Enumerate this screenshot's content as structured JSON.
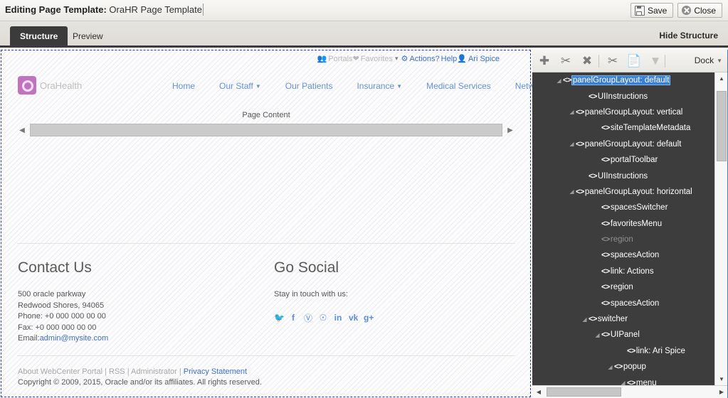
{
  "editor": {
    "title_label": "Editing Page Template:",
    "template_name": "OraHR Page Template",
    "save_label": "Save",
    "close_label": "Close",
    "save_icon": "save-disk-icon",
    "close_icon": "close-circle-icon"
  },
  "tabs": {
    "structure": "Structure",
    "preview": "Preview",
    "hide_structure": "Hide Structure"
  },
  "preview": {
    "utility": {
      "portals": "Portals",
      "favorites": "Favorites",
      "favorites_caret": "▾",
      "actions": "Actions",
      "help": "Help",
      "user": "Ari Spice",
      "portals_icon": "people-icon",
      "favorites_icon": "heart-icon",
      "actions_icon": "gear-icon",
      "help_icon": "question-icon",
      "user_icon": "person-icon"
    },
    "brand": {
      "logo_icon": "ring-logo-icon",
      "name": "OraHealth"
    },
    "nav": [
      {
        "label": "Home",
        "has_dropdown": false
      },
      {
        "label": "Our Staff",
        "has_dropdown": true
      },
      {
        "label": "Our Patients",
        "has_dropdown": false
      },
      {
        "label": "Insurance",
        "has_dropdown": true
      },
      {
        "label": "Medical Services",
        "has_dropdown": false
      },
      {
        "label": "Networking",
        "has_dropdown": false
      }
    ],
    "page_content": {
      "label": "Page Content",
      "left_arrow": "◀",
      "right_arrow": "▶"
    },
    "contact": {
      "heading": "Contact Us",
      "line1": "500 oracle parkway",
      "line2": "Redwood Shores, 94065",
      "line3": "Phone: +0 000 000 00 00",
      "line4": "Fax: +0 000 000 00 00",
      "email_label": "Email:",
      "email": "admin@mysite.com"
    },
    "social": {
      "heading": "Go Social",
      "subtitle": "Stay in touch with us:",
      "icons": [
        {
          "name": "twitter-icon",
          "glyph": "🐦"
        },
        {
          "name": "facebook-icon",
          "glyph": "f"
        },
        {
          "name": "pinterest-icon",
          "glyph": "P"
        },
        {
          "name": "github-icon",
          "glyph": "○"
        },
        {
          "name": "linkedin-icon",
          "glyph": "in"
        },
        {
          "name": "vk-icon",
          "glyph": "VK"
        },
        {
          "name": "googleplus-icon",
          "glyph": "g+"
        }
      ]
    },
    "footer": {
      "about": "About WebCenter Portal",
      "sep": " | ",
      "rss": "RSS",
      "administrator": "Administrator",
      "privacy": "Privacy Statement",
      "copyright": "Copyright © 2009, 2015, Oracle and/or its affiliates. All rights reserved."
    }
  },
  "structure_panel": {
    "toolbar": {
      "add_icon": "plus-icon",
      "edit_icon": "wrench-icon",
      "delete_icon": "x-icon",
      "cut_icon": "scissors-icon",
      "copy_icon": "copy-icon",
      "paste_icon": "paste-icon",
      "dock_label": "Dock",
      "dock_caret": "▾"
    },
    "tree": [
      {
        "label": "panelGroupLayout: default",
        "depth": 1,
        "twisty": "expanded",
        "selected": true,
        "dim": false
      },
      {
        "label": "UIInstructions",
        "depth": 3,
        "twisty": "none",
        "selected": false,
        "dim": false
      },
      {
        "label": "panelGroupLayout: vertical",
        "depth": 2,
        "twisty": "expanded",
        "selected": false,
        "dim": false
      },
      {
        "label": "siteTemplateMetadata",
        "depth": 4,
        "twisty": "none",
        "selected": false,
        "dim": false
      },
      {
        "label": "panelGroupLayout: default",
        "depth": 2,
        "twisty": "expanded",
        "selected": false,
        "dim": false
      },
      {
        "label": "portalToolbar",
        "depth": 4,
        "twisty": "none",
        "selected": false,
        "dim": false
      },
      {
        "label": "UIInstructions",
        "depth": 3,
        "twisty": "none",
        "selected": false,
        "dim": false
      },
      {
        "label": "panelGroupLayout: horizontal",
        "depth": 2,
        "twisty": "expanded",
        "selected": false,
        "dim": false
      },
      {
        "label": "spacesSwitcher",
        "depth": 4,
        "twisty": "none",
        "selected": false,
        "dim": false
      },
      {
        "label": "favoritesMenu",
        "depth": 4,
        "twisty": "none",
        "selected": false,
        "dim": false
      },
      {
        "label": "region",
        "depth": 4,
        "twisty": "none",
        "selected": false,
        "dim": true
      },
      {
        "label": "spacesAction",
        "depth": 4,
        "twisty": "none",
        "selected": false,
        "dim": false
      },
      {
        "label": "link: Actions",
        "depth": 4,
        "twisty": "none",
        "selected": false,
        "dim": false
      },
      {
        "label": "region",
        "depth": 4,
        "twisty": "none",
        "selected": false,
        "dim": false
      },
      {
        "label": "spacesAction",
        "depth": 4,
        "twisty": "none",
        "selected": false,
        "dim": false
      },
      {
        "label": "switcher",
        "depth": 3,
        "twisty": "expanded",
        "selected": false,
        "dim": false
      },
      {
        "label": "UIPanel",
        "depth": 4,
        "twisty": "expanded",
        "selected": false,
        "dim": false
      },
      {
        "label": "link: Ari Spice",
        "depth": 6,
        "twisty": "none",
        "selected": false,
        "dim": false
      },
      {
        "label": "popup",
        "depth": 5,
        "twisty": "expanded",
        "selected": false,
        "dim": false
      },
      {
        "label": "menu",
        "depth": 6,
        "twisty": "expanded",
        "selected": false,
        "dim": false
      }
    ],
    "scroll": {
      "up_arrow": "▲",
      "down_arrow": "▼",
      "left_arrow": "◀",
      "right_arrow": "▶"
    }
  },
  "colors": {
    "accent_blue": "#3a7fd0",
    "nav_link": "#6391d6",
    "panel_dark": "#3d3d3d",
    "tab_active": "#3b3b3b",
    "logo": "#c173c0",
    "selection_outline": "#2d35d6"
  }
}
